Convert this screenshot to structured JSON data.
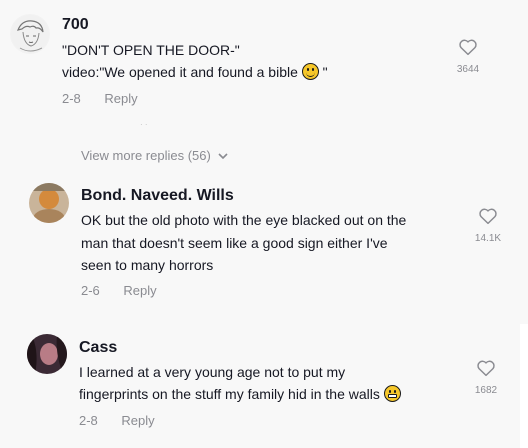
{
  "comments": [
    {
      "username": "700",
      "line1": "\"DON'T OPEN THE DOOR-\"",
      "line2": "video:\"We opened it and found a bible",
      "line2_end": "\"",
      "date": "2-8",
      "reply_label": "Reply",
      "likes": "3644"
    },
    {
      "username": "Bond. Naveed. Wills",
      "line1": "OK but the old photo with the eye blacked out on the",
      "line2": "man that doesn't seem like a good sign either I've",
      "line3": "seen to many horrors",
      "date": "2-6",
      "reply_label": "Reply",
      "likes": "14.1K"
    },
    {
      "username": "Cass",
      "line1": "I learned at a very young age not to put my",
      "line2": "fingerprints on the stuff my family hid in the walls",
      "date": "2-8",
      "reply_label": "Reply",
      "likes": "1682"
    }
  ],
  "view_more_label": "View more replies (56)",
  "icons": {
    "like": "heart-outline-icon",
    "chevron": "chevron-down-icon",
    "emoji1": "smiling-face-icon",
    "emoji2": "grimacing-face-icon"
  }
}
